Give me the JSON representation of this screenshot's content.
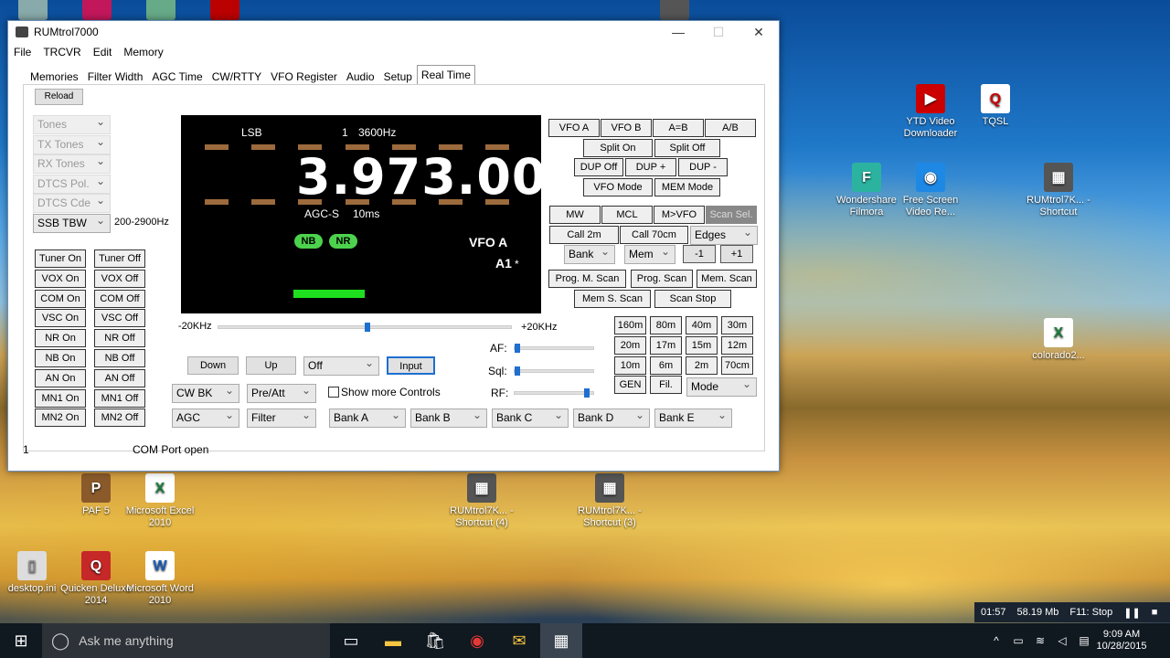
{
  "window": {
    "title": "RUMtrol7000",
    "menu": [
      "File",
      "TRCVR",
      "Edit",
      "Memory"
    ],
    "minimize": "—",
    "maximize": "☐",
    "close": "✕"
  },
  "tabs": [
    "Memories",
    "Filter Width",
    "AGC Time",
    "CW/RTTY",
    "VFO Register",
    "Audio",
    "Setup",
    "Real Time"
  ],
  "active_tab": "Real Time",
  "reload": "Reload",
  "left_dropdowns": [
    "Tones",
    "TX Tones",
    "RX Tones",
    "DTCS Pol.",
    "DTCS Cde",
    "SSB TBW"
  ],
  "ssb_tbw_value": "200-2900Hz",
  "toggles": [
    [
      "Tuner On",
      "Tuner Off"
    ],
    [
      "VOX On",
      "VOX Off"
    ],
    [
      "COM On",
      "COM Off"
    ],
    [
      "VSC On",
      "VSC Off"
    ],
    [
      "NR On",
      "NR Off"
    ],
    [
      "NB On",
      "NB Off"
    ],
    [
      "AN On",
      "AN Off"
    ],
    [
      "MN1 On",
      "MN1 Off"
    ],
    [
      "MN2 On",
      "MN2 Off"
    ]
  ],
  "display": {
    "mode": "LSB",
    "filter_num": "1",
    "filter_width": "3600Hz",
    "frequency": "3.973.000",
    "agc": "AGC-S",
    "agc_time": "10ms",
    "nb": "NB",
    "nr": "NR",
    "vfo": "VFO A",
    "a1": "A1",
    "a1_mark": "*"
  },
  "shift": {
    "left": "-20KHz",
    "right": "+20KHz",
    "position": 0.5
  },
  "controls": {
    "down": "Down",
    "up": "Up",
    "off": "Off",
    "input": "Input",
    "cw_bk": "CW BK",
    "pre_att": "Pre/Att",
    "show_more": "Show more Controls",
    "agc": "AGC",
    "filter": "Filter",
    "banks": [
      "Bank A",
      "Bank B",
      "Bank C",
      "Bank D",
      "Bank E"
    ]
  },
  "levels": {
    "af_label": "AF:",
    "af": 0.0,
    "sql_label": "Sql:",
    "sql": 0.0,
    "rf_label": "RF:",
    "rf": 0.95
  },
  "right_buttons": {
    "vfo": [
      "VFO A",
      "VFO B",
      "A=B",
      "A/B"
    ],
    "split": [
      "Split On",
      "Split Off"
    ],
    "dup": [
      "DUP Off",
      "DUP +",
      "DUP -"
    ],
    "mode": [
      "VFO Mode",
      "MEM Mode"
    ],
    "mem": [
      "MW",
      "MCL",
      "M>VFO",
      "Scan Sel."
    ],
    "call": [
      "Call 2m",
      "Call 70cm"
    ],
    "edges": "Edges",
    "bank": "Bank",
    "memdd": "Mem",
    "minus": "-1",
    "plus": "+1",
    "scan1": [
      "Prog. M. Scan",
      "Prog. Scan",
      "Mem. Scan"
    ],
    "scan2": [
      "Mem S. Scan",
      "Scan Stop"
    ],
    "bands": [
      "160m",
      "80m",
      "40m",
      "30m",
      "20m",
      "17m",
      "15m",
      "12m",
      "10m",
      "6m",
      "2m",
      "70cm"
    ],
    "gen": "GEN",
    "fil": "Fil.",
    "mode_dd": "Mode"
  },
  "status": {
    "left": "1",
    "right": "COM Port open"
  },
  "desktop_icons": [
    "YTD Video Downloader",
    "TQSL",
    "Wondershare Filmora",
    "Free Screen Video Re...",
    "RUMtrol7K... - Shortcut",
    "colorado2...",
    "PAF 5",
    "Microsoft Excel 2010",
    "RUMtrol7K... - Shortcut (4)",
    "RUMtrol7K... - Shortcut (3)",
    "desktop.ini",
    "Quicken Deluxe 2014",
    "Microsoft Word 2010"
  ],
  "recorder": {
    "time": "01:57",
    "size": "58.19 Mb",
    "stop": "F11: Stop"
  },
  "taskbar": {
    "search": "Ask me anything",
    "clock": "9:09 AM",
    "date": "10/28/2015"
  }
}
